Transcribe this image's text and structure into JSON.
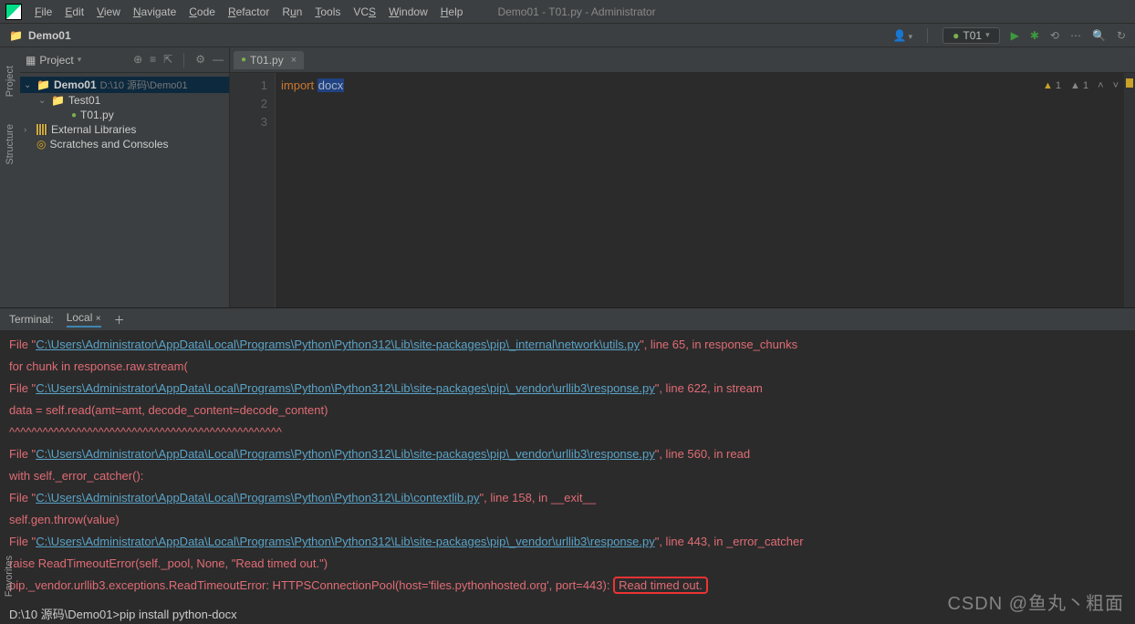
{
  "window_title": "Demo01 - T01.py - Administrator",
  "menu": [
    "File",
    "Edit",
    "View",
    "Navigate",
    "Code",
    "Refactor",
    "Run",
    "Tools",
    "VCS",
    "Window",
    "Help"
  ],
  "breadcrumb": {
    "project": "Demo01"
  },
  "run_config": "T01",
  "project_pane": {
    "title": "Project",
    "root": {
      "name": "Demo01",
      "path": "D:\\10 源码\\Demo01"
    },
    "test_folder": "Test01",
    "file": "T01.py",
    "external": "External Libraries",
    "scratches": "Scratches and Consoles"
  },
  "sidebar": {
    "project": "Project",
    "structure": "Structure",
    "favorites": "Favorites"
  },
  "editor": {
    "tab": "T01.py",
    "lines": [
      "1",
      "2",
      "3"
    ],
    "code": {
      "kw": "import",
      "mod": "docx"
    },
    "warn1": "1",
    "warn2": "1"
  },
  "terminal": {
    "title": "Terminal:",
    "tab": "Local",
    "lines": [
      {
        "pre": "  File \"",
        "link": "C:\\Users\\Administrator\\AppData\\Local\\Programs\\Python\\Python312\\Lib\\site-packages\\pip\\_internal\\network\\utils.py",
        "post": "\", line 65, in response_chunks"
      },
      {
        "text": "    for chunk in response.raw.stream("
      },
      {
        "pre": "  File \"",
        "link": "C:\\Users\\Administrator\\AppData\\Local\\Programs\\Python\\Python312\\Lib\\site-packages\\pip\\_vendor\\urllib3\\response.py",
        "post": "\", line 622, in stream"
      },
      {
        "text": "    data = self.read(amt=amt, decode_content=decode_content)"
      },
      {
        "text": "           ^^^^^^^^^^^^^^^^^^^^^^^^^^^^^^^^^^^^^^^^^^^^^^^^^"
      },
      {
        "pre": "  File \"",
        "link": "C:\\Users\\Administrator\\AppData\\Local\\Programs\\Python\\Python312\\Lib\\site-packages\\pip\\_vendor\\urllib3\\response.py",
        "post": "\", line 560, in read"
      },
      {
        "text": "    with self._error_catcher():"
      },
      {
        "pre": "  File \"",
        "link": "C:\\Users\\Administrator\\AppData\\Local\\Programs\\Python\\Python312\\Lib\\contextlib.py",
        "post": "\", line 158, in __exit__"
      },
      {
        "text": "    self.gen.throw(value)"
      },
      {
        "pre": "  File \"",
        "link": "C:\\Users\\Administrator\\AppData\\Local\\Programs\\Python\\Python312\\Lib\\site-packages\\pip\\_vendor\\urllib3\\response.py",
        "post": "\", line 443, in _error_catcher"
      },
      {
        "text": "    raise ReadTimeoutError(self._pool, None, \"Read timed out.\")"
      }
    ],
    "final_pre": "pip._vendor.urllib3.exceptions.ReadTimeoutError: HTTPSConnectionPool(host='files.pythonhosted.org', port=443): ",
    "final_box": "Read timed out.",
    "prompt": "D:\\10 源码\\Demo01>pip install python-docx"
  },
  "watermark": "CSDN @鱼丸丶粗面"
}
